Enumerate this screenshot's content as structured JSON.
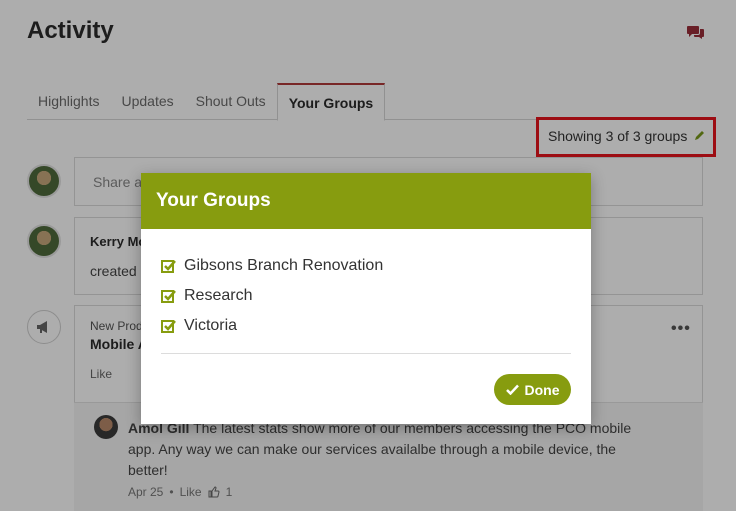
{
  "page": {
    "title": "Activity"
  },
  "tabs": [
    {
      "label": "Highlights"
    },
    {
      "label": "Updates"
    },
    {
      "label": "Shout Outs"
    },
    {
      "label": "Your Groups"
    }
  ],
  "filter": {
    "showing_text": "Showing 3 of 3 groups"
  },
  "share": {
    "placeholder": "Share a"
  },
  "post1": {
    "author": "Kerry Mo",
    "text": "created"
  },
  "post2": {
    "category": "New Prod",
    "title": "Mobile A",
    "like": "Like"
  },
  "comment": {
    "author": "Amol Gill",
    "text": "The latest stats show more of our members accessing the PCO mobile app. Any way we can make our services availalbe through a mobile device, the better!",
    "date": "Apr 25",
    "like": "Like",
    "like_count": "1"
  },
  "modal": {
    "title": "Your Groups",
    "groups": [
      {
        "label": "Gibsons Branch Renovation",
        "checked": true
      },
      {
        "label": "Research",
        "checked": true
      },
      {
        "label": "Victoria",
        "checked": true
      }
    ],
    "done_label": "Done"
  },
  "colors": {
    "accent_green": "#879c0f",
    "tab_active_border": "#b23a3a",
    "highlight_red": "#e8141c"
  },
  "icons": {
    "chat": "chat-bubbles-icon",
    "pencil": "pencil-icon",
    "megaphone": "megaphone-icon",
    "check": "checkbox-checked-icon",
    "done": "checkmark-icon",
    "like": "thumbs-up-icon"
  }
}
